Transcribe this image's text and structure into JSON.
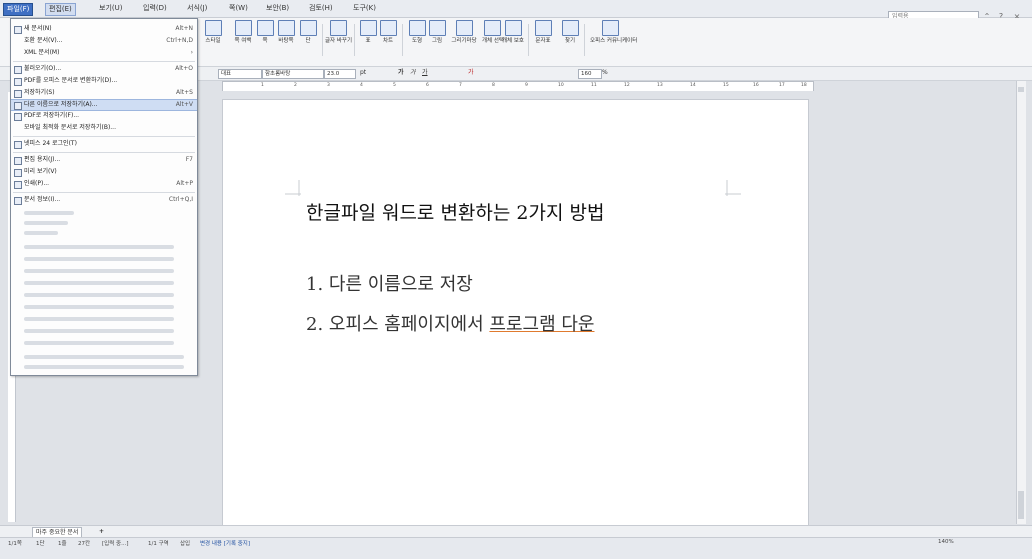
{
  "menu": {
    "items": [
      "파일(F)",
      "편집(E)",
      "보기(U)",
      "입력(D)",
      "서식(J)",
      "쪽(W)",
      "보안(B)",
      "검토(H)",
      "도구(K)"
    ],
    "search_value": "입력용",
    "window": {
      "minimize": "⌃",
      "restore": "?",
      "close": "×"
    }
  },
  "toolbar": {
    "groups": [
      {
        "label": "스타일"
      },
      {
        "label": "쪽 여백"
      },
      {
        "label": "쪽"
      },
      {
        "label": "바탕쪽"
      },
      {
        "label": "단"
      },
      {
        "label": "글자 바꾸기"
      },
      {
        "label": "표"
      },
      {
        "label": "차트"
      },
      {
        "label": "도형"
      },
      {
        "label": "그림"
      },
      {
        "label": "그리기마당"
      },
      {
        "label": "개체 선택"
      },
      {
        "label": "개체 보호"
      },
      {
        "label": "문자표"
      },
      {
        "label": "찾기"
      },
      {
        "label": "오피스 커뮤니케이터"
      }
    ]
  },
  "format": {
    "style": "대표",
    "font": "함초롬바탕",
    "size": "23.0",
    "unit": "pt",
    "bold": "가",
    "italic": "가",
    "underline": "가",
    "line_spacing": "160",
    "percent": "%"
  },
  "ruler": {
    "ticks": [
      "1",
      "2",
      "3",
      "4",
      "5",
      "6",
      "7",
      "8",
      "9",
      "10",
      "11",
      "12",
      "13",
      "14",
      "15",
      "16",
      "17",
      "18"
    ]
  },
  "document": {
    "title": "한글파일 워드로 변환하는 2가지 방법",
    "line1": "1. 다른 이름으로 저장",
    "line2_plain": "2. 오피스 홈페이지에서 ",
    "line2_underlined": "프로그램 다운"
  },
  "file_menu": {
    "items": [
      {
        "label": "새 문서(N)",
        "shortcut": "Alt+N",
        "sub": "›"
      },
      {
        "label": "호환 문서(V)...",
        "shortcut": "Ctrl+N,D"
      },
      {
        "label": "XML 문서(M)",
        "shortcut": "",
        "sub": "›"
      },
      {
        "label": "불러오기(O)...",
        "shortcut": "Alt+O"
      },
      {
        "label": "PDF를 오피스 문서로 변환하기(D)...",
        "shortcut": ""
      },
      {
        "label": "저장하기(S)",
        "shortcut": "Alt+S"
      },
      {
        "label": "다른 이름으로 저장하기(A)...",
        "shortcut": "Alt+V"
      },
      {
        "label": "PDF로 저장하기(F)...",
        "shortcut": ""
      },
      {
        "label": "모바일 최적화 문서로 저장하기(B)...",
        "shortcut": ""
      },
      {
        "label": "넷피스 24 로그인(T)",
        "shortcut": ""
      },
      {
        "label": "편집 용지(J)...",
        "shortcut": "F7"
      },
      {
        "label": "미리 보기(V)",
        "shortcut": ""
      },
      {
        "label": "인쇄(P)...",
        "shortcut": "Alt+P"
      },
      {
        "label": "문서 정보(I)...",
        "shortcut": "Ctrl+Q,I"
      }
    ]
  },
  "tabs": {
    "doc_tab": "마주 중요한 문서",
    "add": "+"
  },
  "status": {
    "page": "1/1쪽",
    "section": "1단",
    "line": "1줄",
    "col": "27칸",
    "input": "[입력 중...]",
    "area": "1/1 구역",
    "mode": "삽입",
    "track": "변경 내용 [기록 중지]",
    "zoom": "140%"
  }
}
